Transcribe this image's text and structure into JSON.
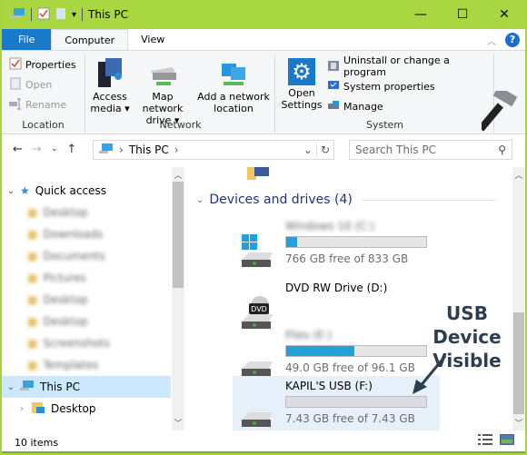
{
  "window": {
    "title": "This PC",
    "controls": {
      "minimize": "—",
      "maximize": "☐",
      "close": "✕"
    }
  },
  "tabs": [
    {
      "label": "File"
    },
    {
      "label": "Computer"
    },
    {
      "label": "View"
    }
  ],
  "ribbon": {
    "location": {
      "label": "Location",
      "items": [
        {
          "label": "Properties",
          "enabled": true
        },
        {
          "label": "Open",
          "enabled": false
        },
        {
          "label": "Rename",
          "enabled": false
        }
      ]
    },
    "network": {
      "label": "Network",
      "access_media": {
        "line1": "Access",
        "line2": "media ▾"
      },
      "map_drive": {
        "line1": "Map network",
        "line2": "drive ▾"
      },
      "add_location": {
        "line1": "Add a network",
        "line2": "location"
      }
    },
    "system": {
      "label": "System",
      "open_settings": {
        "line1": "Open",
        "line2": "Settings"
      },
      "items": [
        {
          "label": "Uninstall or change a program"
        },
        {
          "label": "System properties"
        },
        {
          "label": "Manage"
        }
      ]
    }
  },
  "address": {
    "path": "This PC",
    "search_placeholder": "Search This PC"
  },
  "nav_pane": {
    "quick_access": "Quick access",
    "quick_items": [
      {
        "label": "Desktop",
        "pinned": true
      },
      {
        "label": "Downloads",
        "pinned": true
      },
      {
        "label": "Documents",
        "pinned": true
      },
      {
        "label": "Pictures",
        "pinned": true
      },
      {
        "label": "Desktop",
        "pinned": false
      },
      {
        "label": "Desktop",
        "pinned": false
      },
      {
        "label": "Screenshots",
        "pinned": false
      },
      {
        "label": "Templates",
        "pinned": false
      }
    ],
    "this_pc": "This PC",
    "desktop": "Desktop"
  },
  "content": {
    "group_header": "Devices and drives (4)",
    "drives": [
      {
        "name": "Windows 10 (C:)",
        "free": "766 GB free of 833 GB",
        "used_fraction": 0.08,
        "has_bar": true
      },
      {
        "name": "DVD RW Drive (D:)",
        "free": "",
        "has_bar": false
      },
      {
        "name": "Files (E:)",
        "free": "49.0 GB free of 96.1 GB",
        "used_fraction": 0.49,
        "has_bar": true
      },
      {
        "name": "KAPIL'S USB (F:)",
        "free": "7.43 GB free of 7.43 GB",
        "used_fraction": 0.0,
        "has_bar": true
      }
    ]
  },
  "annotation": {
    "line1": "USB Device",
    "line2": "Visible"
  },
  "status": {
    "items": "10 items"
  },
  "colors": {
    "accent": "#1979ca",
    "title_bar": "#a9d742",
    "selection": "#cce8ff",
    "drive_bar": "#26a0da"
  }
}
